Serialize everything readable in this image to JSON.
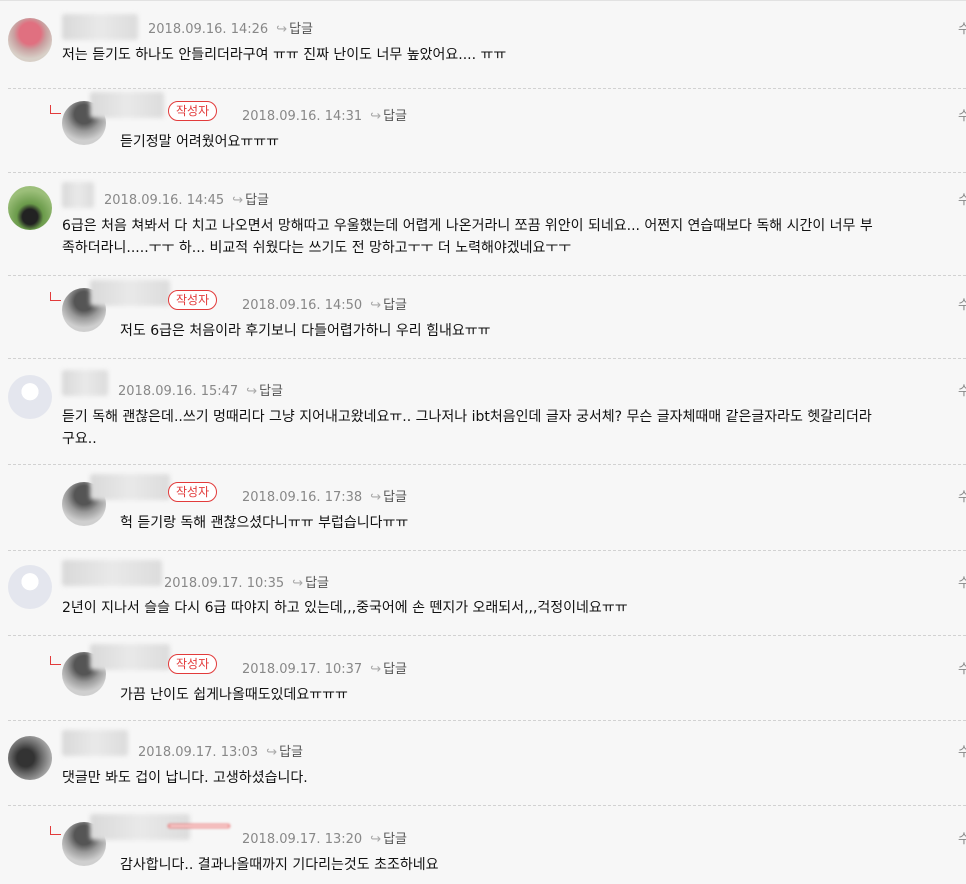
{
  "reply_label": "답글",
  "author_badge": "작성자",
  "edge_glyph": "수",
  "comments": [
    {
      "date": "2018.09.16. 14:26",
      "text": "저는 듣기도 하나도 안들리더라구여 ㅠㅠ 진짜 난이도 너무 높았어요.... ㅠㅠ",
      "is_author": false
    },
    {
      "date": "2018.09.16. 14:31",
      "text": "듣기정말 어려웠어요ㅠㅠㅠ",
      "is_author": true
    },
    {
      "date": "2018.09.16. 14:45",
      "text": "6급은 처음 쳐봐서 다 치고 나오면서 망해따고 우울했는데 어렵게 나온거라니 쪼끔 위안이 되네요... 어쩐지 연습때보다 독해 시간이 너무 부\n족하더라니.....ㅜㅜ 하... 비교적 쉬웠다는 쓰기도 전 망하고ㅜㅜ 더 노력해야겠네요ㅜㅜ",
      "is_author": false
    },
    {
      "date": "2018.09.16. 14:50",
      "text": "저도 6급은 처음이라 후기보니 다들어렵가하니 우리 힘내요ㅠㅠ",
      "is_author": true
    },
    {
      "date": "2018.09.16. 15:47",
      "text": "듣기 독해 괜찮은데..쓰기 멍때리다 그냥 지어내고왔네요ㅠ.. 그나저나 ibt처음인데 글자 궁서체? 무슨 글자체때매 같은글자라도 헷갈리더라\n구요..",
      "is_author": false
    },
    {
      "date": "2018.09.16. 17:38",
      "text": "헉 듣기랑 독해 괜찮으셨다니ㅠㅠ 부럽습니다ㅠㅠ",
      "is_author": true
    },
    {
      "date": "2018.09.17. 10:35",
      "text": "2년이 지나서 슬슬 다시 6급 따야지 하고 있는데,,,중국어에 손 뗀지가 오래되서,,,걱정이네요ㅠㅠ",
      "is_author": false
    },
    {
      "date": "2018.09.17. 10:37",
      "text": "가끔 난이도 쉽게나올때도있데요ㅠㅠㅠ",
      "is_author": true
    },
    {
      "date": "2018.09.17. 13:03",
      "text": "댓글만 봐도 겁이 납니다. 고생하셨습니다.",
      "is_author": false
    },
    {
      "date": "2018.09.17. 13:20",
      "text": "감사합니다.. 결과나올때까지 기다리는것도 초조하네요",
      "is_author": true
    }
  ],
  "colors": {
    "accent": "#e23b3b",
    "meta": "#888888",
    "text": "#111111",
    "background": "#f7f7f7"
  }
}
